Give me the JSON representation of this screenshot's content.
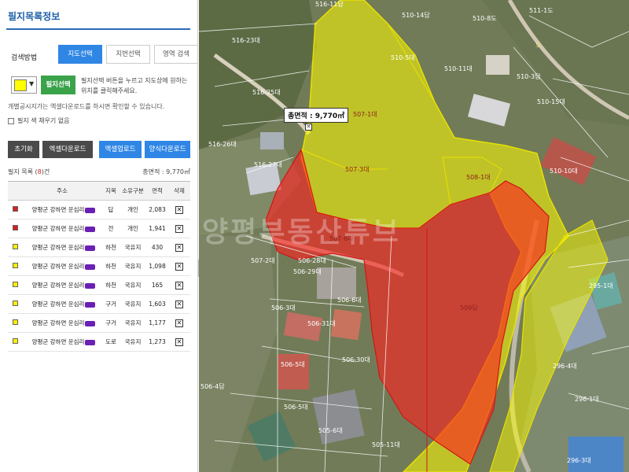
{
  "panel": {
    "title": "필지목록정보",
    "search_label": "검색방법",
    "tabs": [
      "지도선택",
      "지번선택",
      "영역 검색"
    ],
    "select_button": "필지선택",
    "help_text": "필지선택 버튼을 누르고 지도상에 원하는 위치를 클릭해주세요.",
    "notice": "개별공시지가는 엑셀다운로드를 하시면 확인할 수 있습니다.",
    "fill_label": "필지 색 채우기 없음",
    "current_color": "#ffff00",
    "buttons": {
      "reset": "초기화",
      "excel_download": "엑셀다운로드",
      "excel_upload": "엑셀업로드",
      "form_download": "양식다운로드"
    },
    "count_prefix": "필지 목록 (",
    "count_value": "8",
    "count_suffix": ")건",
    "area_total": "총면적 : 9,770㎡"
  },
  "table": {
    "headers": [
      "주소",
      "지목",
      "소유구분",
      "면적",
      "삭제"
    ],
    "rows": [
      {
        "color": "#d91d1d",
        "address": "양평군 강하면 운심리",
        "category": "답",
        "owner": "개인",
        "area": "2,083"
      },
      {
        "color": "#d91d1d",
        "address": "양평군 강하면 운심리",
        "category": "전",
        "owner": "개인",
        "area": "1,941"
      },
      {
        "color": "#ffee00",
        "address": "양평군 강하면 운심리",
        "category": "하천",
        "owner": "국유지",
        "area": "430"
      },
      {
        "color": "#ffee00",
        "address": "양평군 강하면 운심리",
        "category": "하천",
        "owner": "국유지",
        "area": "1,098"
      },
      {
        "color": "#ffee00",
        "address": "양평군 강하면 운심리",
        "category": "하천",
        "owner": "국유지",
        "area": "165"
      },
      {
        "color": "#ffee00",
        "address": "양평군 강하면 운심리",
        "category": "구거",
        "owner": "국유지",
        "area": "1,603"
      },
      {
        "color": "#ffee00",
        "address": "양평군 강하면 운심리",
        "category": "구거",
        "owner": "국유지",
        "area": "1,177"
      },
      {
        "color": "#ffee00",
        "address": "양평군 강하면 운심리",
        "category": "도로",
        "owner": "국유지",
        "area": "1,273"
      }
    ]
  },
  "map": {
    "total_area_label": "총면적 : 9,770㎡",
    "watermark": "양평부동산튜브",
    "parcel_labels": [
      "516-11답",
      "510-14답",
      "510-8도",
      "511-1도",
      "516-23대",
      "510-5대",
      "510-11대",
      "510-3답",
      "510-15대",
      "516-25대",
      "516-26대",
      "516-27대",
      "510-10대",
      "507-2대",
      "506-28대",
      "506-29대",
      "506-3대",
      "506-6대",
      "506-31대",
      "506-5대",
      "506-4답",
      "506-30대",
      "506-5대",
      "505-6대",
      "505-11대",
      "296-4대",
      "296-1대",
      "296-3대",
      "295-1대",
      "509답",
      "507-1대",
      "507-3대",
      "508-1대",
      "507-6대"
    ],
    "road_label": "도"
  }
}
